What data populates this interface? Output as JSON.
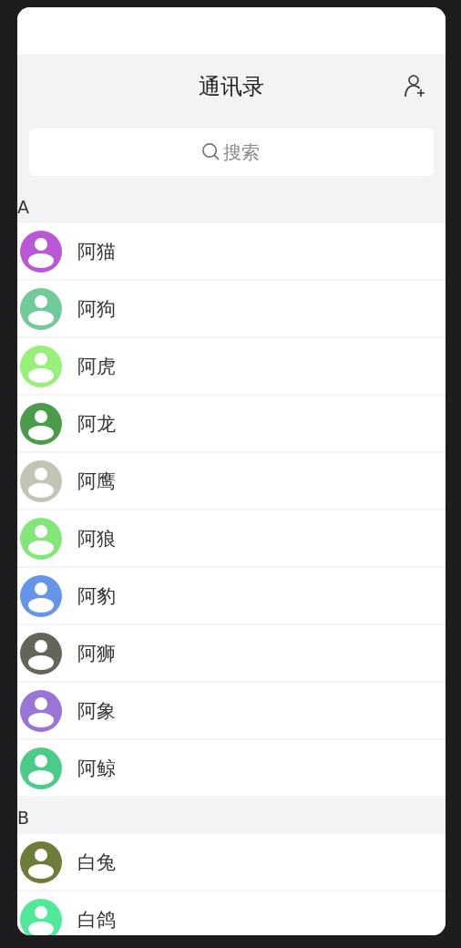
{
  "header": {
    "title": "通讯录"
  },
  "search": {
    "placeholder": "搜索"
  },
  "sections": [
    {
      "letter": "A",
      "contacts": [
        {
          "name": "阿猫",
          "color": "#b858d4"
        },
        {
          "name": "阿狗",
          "color": "#72c99a"
        },
        {
          "name": "阿虎",
          "color": "#98f07a"
        },
        {
          "name": "阿龙",
          "color": "#4a9c4a"
        },
        {
          "name": "阿鹰",
          "color": "#c2c5b5"
        },
        {
          "name": "阿狼",
          "color": "#84e67a"
        },
        {
          "name": "阿豹",
          "color": "#6595e8"
        },
        {
          "name": "阿狮",
          "color": "#62655a"
        },
        {
          "name": "阿象",
          "color": "#9a74d6"
        },
        {
          "name": "阿鲸",
          "color": "#4acc88"
        }
      ]
    },
    {
      "letter": "B",
      "contacts": [
        {
          "name": "白兔",
          "color": "#6e7c3a"
        },
        {
          "name": "白鸽",
          "color": "#52e89a"
        }
      ]
    }
  ]
}
